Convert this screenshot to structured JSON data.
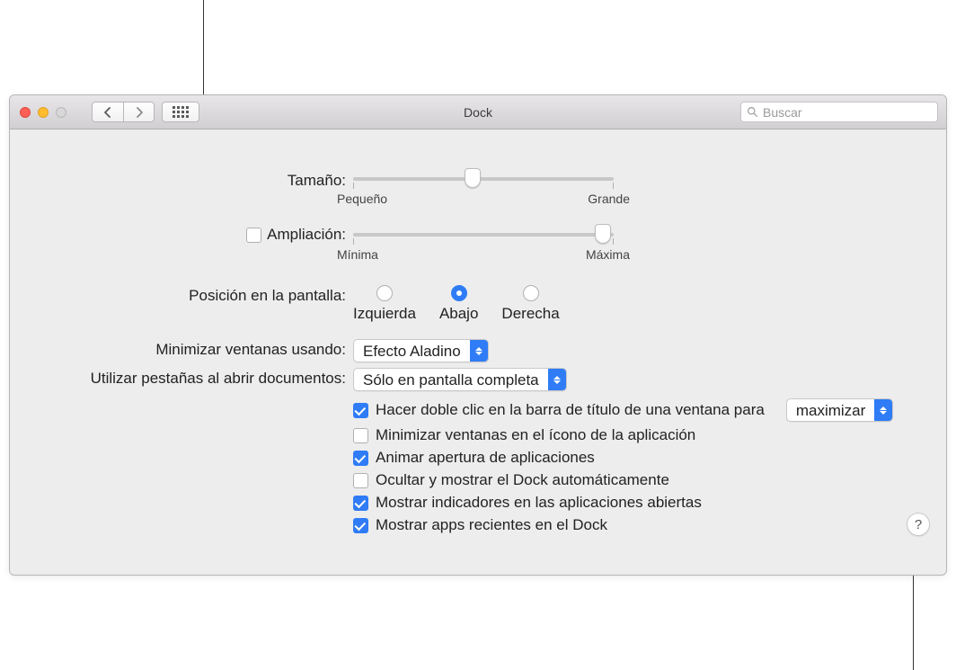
{
  "window_title": "Dock",
  "search": {
    "placeholder": "Buscar"
  },
  "size": {
    "label": "Tamaño:",
    "min": "Pequeño",
    "max": "Grande",
    "value": 46
  },
  "magnification": {
    "label": "Ampliación:",
    "min": "Mínima",
    "max": "Máxima",
    "enabled": false,
    "value": 96
  },
  "position": {
    "label": "Posición en la pantalla:",
    "options": {
      "left": "Izquierda",
      "bottom": "Abajo",
      "right": "Derecha"
    },
    "selected": "bottom"
  },
  "minimize_effect": {
    "label": "Minimizar ventanas usando:",
    "value": "Efecto Aladino"
  },
  "tabs_when_opening": {
    "label": "Utilizar pestañas al abrir documentos:",
    "value": "Sólo en pantalla completa"
  },
  "title_bar_action": {
    "value": "maximizar"
  },
  "checks": {
    "double_click": {
      "label": "Hacer doble clic en la barra de título de una ventana para",
      "checked": true
    },
    "min_into_icon": {
      "label": "Minimizar ventanas en el ícono de la aplicación",
      "checked": false
    },
    "animate": {
      "label": "Animar apertura de aplicaciones",
      "checked": true
    },
    "autohide": {
      "label": "Ocultar y mostrar el Dock automáticamente",
      "checked": false
    },
    "indicators": {
      "label": "Mostrar indicadores en las aplicaciones abiertas",
      "checked": true
    },
    "recents": {
      "label": "Mostrar apps recientes en el Dock",
      "checked": true
    }
  },
  "help_label": "?"
}
